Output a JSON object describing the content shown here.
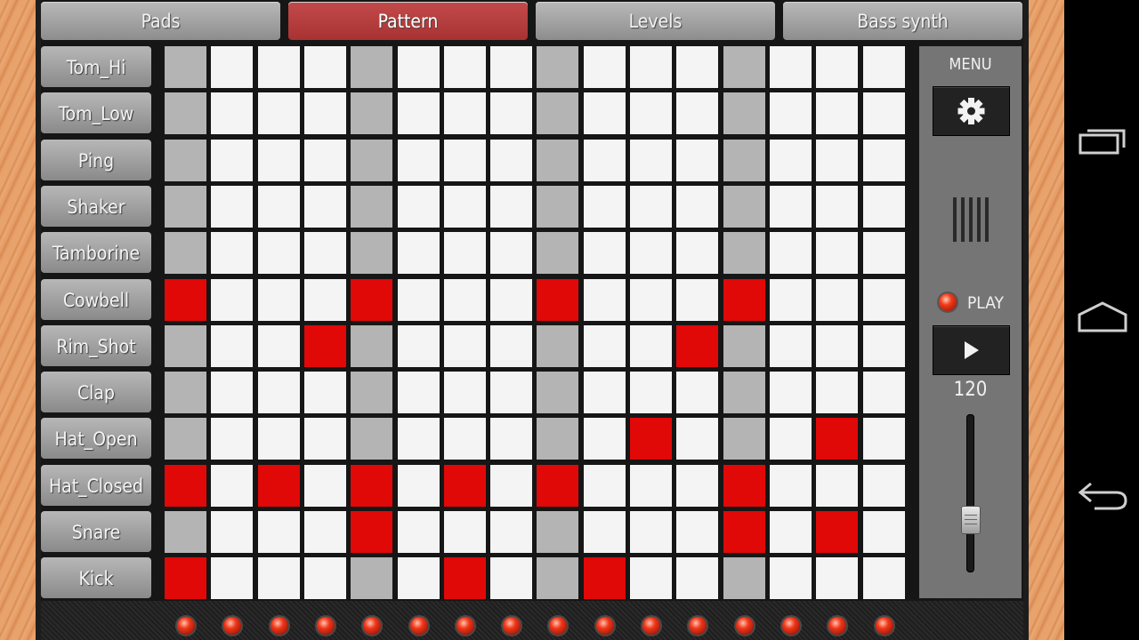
{
  "tabs": [
    {
      "label": "Pads",
      "active": false
    },
    {
      "label": "Pattern",
      "active": true
    },
    {
      "label": "Levels",
      "active": false
    },
    {
      "label": "Bass synth",
      "active": false
    }
  ],
  "instruments": [
    "Tom_Hi",
    "Tom_Low",
    "Ping",
    "Shaker",
    "Tamborine",
    "Cowbell",
    "Rim_Shot",
    "Clap",
    "Hat_Open",
    "Hat_Closed",
    "Snare",
    "Kick"
  ],
  "pattern": [
    [
      0,
      0,
      0,
      0,
      0,
      0,
      0,
      0,
      0,
      0,
      0,
      0,
      0,
      0,
      0,
      0
    ],
    [
      0,
      0,
      0,
      0,
      0,
      0,
      0,
      0,
      0,
      0,
      0,
      0,
      0,
      0,
      0,
      0
    ],
    [
      0,
      0,
      0,
      0,
      0,
      0,
      0,
      0,
      0,
      0,
      0,
      0,
      0,
      0,
      0,
      0
    ],
    [
      0,
      0,
      0,
      0,
      0,
      0,
      0,
      0,
      0,
      0,
      0,
      0,
      0,
      0,
      0,
      0
    ],
    [
      0,
      0,
      0,
      0,
      0,
      0,
      0,
      0,
      0,
      0,
      0,
      0,
      0,
      0,
      0,
      0
    ],
    [
      1,
      0,
      0,
      0,
      1,
      0,
      0,
      0,
      1,
      0,
      0,
      0,
      1,
      0,
      0,
      0
    ],
    [
      0,
      0,
      0,
      1,
      0,
      0,
      0,
      0,
      0,
      0,
      0,
      1,
      0,
      0,
      0,
      0
    ],
    [
      0,
      0,
      0,
      0,
      0,
      0,
      0,
      0,
      0,
      0,
      0,
      0,
      0,
      0,
      0,
      0
    ],
    [
      0,
      0,
      0,
      0,
      0,
      0,
      0,
      0,
      0,
      0,
      1,
      0,
      0,
      0,
      1,
      0
    ],
    [
      1,
      0,
      1,
      0,
      1,
      0,
      1,
      0,
      1,
      0,
      0,
      0,
      1,
      0,
      0,
      0
    ],
    [
      0,
      0,
      0,
      0,
      1,
      0,
      0,
      0,
      0,
      0,
      0,
      0,
      1,
      0,
      1,
      0
    ],
    [
      1,
      0,
      0,
      0,
      0,
      0,
      1,
      0,
      0,
      1,
      0,
      0,
      0,
      0,
      0,
      0
    ]
  ],
  "steps": 16,
  "side_panel": {
    "menu_label": "MENU",
    "settings_icon": "gear-icon",
    "play_label": "PLAY",
    "play_icon": "play-icon",
    "tempo": "120",
    "tempo_slider_fraction": 0.3
  },
  "colors": {
    "active_step": "#e10808",
    "inactive_step": "#f4f4f4",
    "beat_marker_step": "#b4b4b4",
    "active_tab": "#b33b3b"
  },
  "system_nav": [
    "recent-apps-icon",
    "home-icon",
    "back-icon"
  ]
}
